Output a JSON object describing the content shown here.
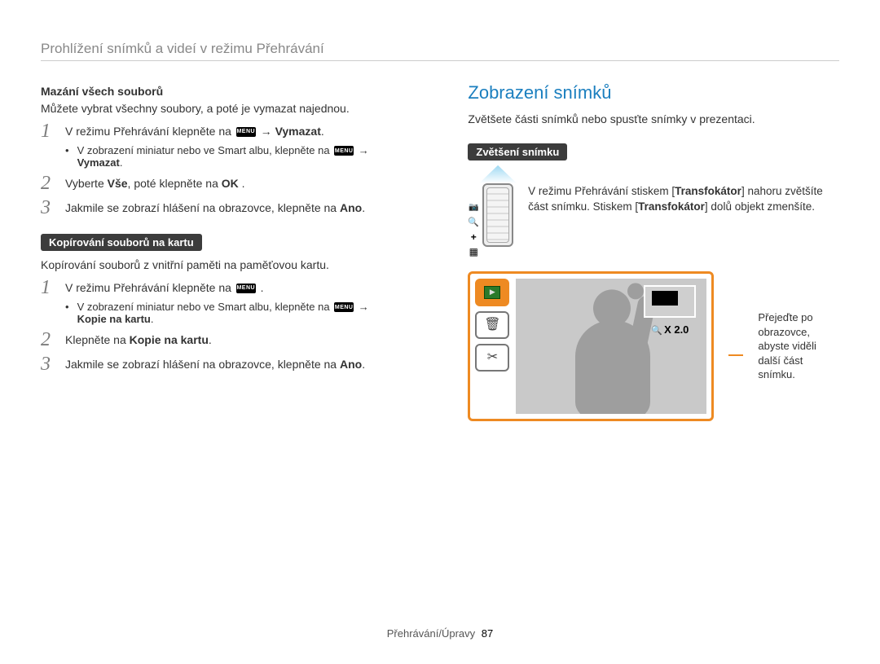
{
  "header": {
    "title": "Prohlížení snímků a videí v režimu Přehrávání"
  },
  "left": {
    "delete_all": {
      "heading": "Mazání všech souborů",
      "intro": "Můžete vybrat všechny soubory, a poté je vymazat najednou.",
      "step1_a": "V režimu Přehrávání klepněte na ",
      "step1_b": " → ",
      "step1_c": "Vymazat",
      "step1_d": ".",
      "bullet_a": "V zobrazení miniatur nebo ve Smart albu, klepněte na ",
      "bullet_b": " →",
      "bullet_c": "Vymazat",
      "bullet_d": ".",
      "step2_a": "Vyberte ",
      "step2_b": "Vše",
      "step2_c": ", poté klepněte na ",
      "ok": "OK",
      "step2_d": " .",
      "step3_a": "Jakmile se zobrazí hlášení na obrazovce, klepněte na ",
      "step3_b": "Ano",
      "step3_c": "."
    },
    "copy": {
      "pill": "Kopírování souborů na kartu",
      "intro": "Kopírování souborů z vnitřní paměti na paměťovou kartu.",
      "step1_a": "V režimu Přehrávání klepněte na ",
      "step1_b": " .",
      "bullet_a": "V zobrazení miniatur nebo ve Smart albu, klepněte na ",
      "bullet_b": " →",
      "bullet_c": "Kopie na kartu",
      "bullet_d": ".",
      "step2_a": "Klepněte na ",
      "step2_b": "Kopie na kartu",
      "step2_c": ".",
      "step3_a": "Jakmile se zobrazí hlášení na obrazovce, klepněte na ",
      "step3_b": "Ano",
      "step3_c": "."
    }
  },
  "right": {
    "title": "Zobrazení snímků",
    "intro": "Zvětšete části snímků nebo spusťte snímky v prezentaci.",
    "zoom_pill": "Zvětšení snímku",
    "zoom_text_a": "V režimu Přehrávání stiskem [",
    "zoom_text_b": "Transfokátor",
    "zoom_text_c": "] nahoru zvětšíte část snímku. Stiskem [",
    "zoom_text_d": "Transfokátor",
    "zoom_text_e": "] dolů objekt zmenšíte.",
    "zoom_level": "X 2.0",
    "caption": "Přejeďte po obrazovce, abyste viděli další část snímku."
  },
  "icons": {
    "menu": "MENU",
    "play": "▶",
    "trash": "🗑",
    "scissors": "✂"
  },
  "footer": {
    "section": "Přehrávání/Úpravy",
    "page": "87"
  }
}
